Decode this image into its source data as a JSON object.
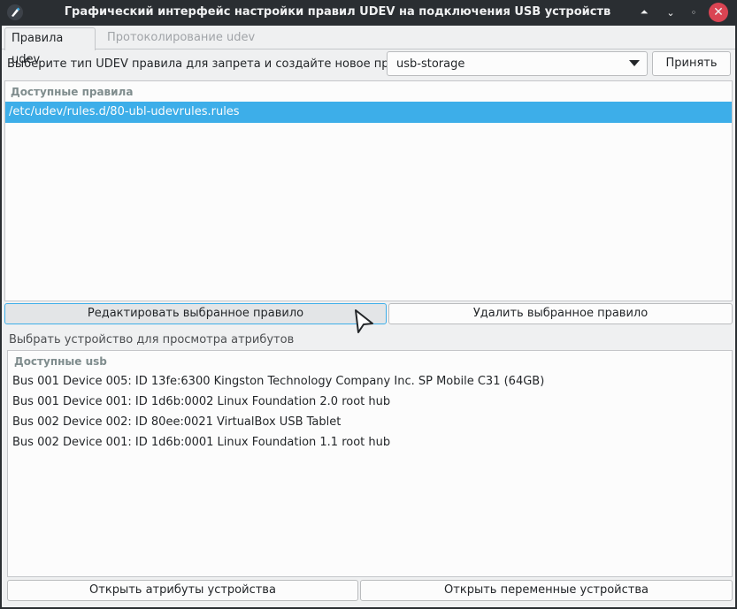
{
  "window": {
    "title": "Графический интерфейс настройки правил UDEV на подключения USB устройств",
    "controls": {
      "keep_above_glyph": "⏶",
      "minimize_glyph": "⌄",
      "maximize_glyph": "◦",
      "close_glyph": "✕"
    }
  },
  "tabs": [
    {
      "label": "Правила udev",
      "active": true
    },
    {
      "label": "Протоколирование udev",
      "active": false
    }
  ],
  "rule_type": {
    "label": "Выберите тип UDEV правила для запрета и создайте новое правило",
    "selected": "usb-storage",
    "accept_label": "Принять"
  },
  "rules": {
    "header": "Доступные правила",
    "items": [
      "/etc/udev/rules.d/80-ubl-udevrules.rules"
    ]
  },
  "rule_actions": {
    "edit_label": "Редактировать выбранное правило",
    "delete_label": "Удалить выбранное правило"
  },
  "devices": {
    "section_label": "Выбрать устройство для просмотра атрибутов",
    "header": "Доступные usb",
    "items": [
      "Bus 001 Device 005: ID 13fe:6300 Kingston Technology Company Inc. SP Mobile C31 (64GB)",
      "Bus 001 Device 001: ID 1d6b:0002 Linux Foundation 2.0 root hub",
      "Bus 002 Device 002: ID 80ee:0021 VirtualBox USB Tablet",
      "Bus 002 Device 001: ID 1d6b:0001 Linux Foundation 1.1 root hub"
    ]
  },
  "device_actions": {
    "attributes_label": "Открыть атрибуты устройства",
    "variables_label": "Открыть переменные устройства"
  },
  "colors": {
    "selection": "#3daee9",
    "close_button": "#da4453",
    "titlebar": "#2a2e32"
  }
}
